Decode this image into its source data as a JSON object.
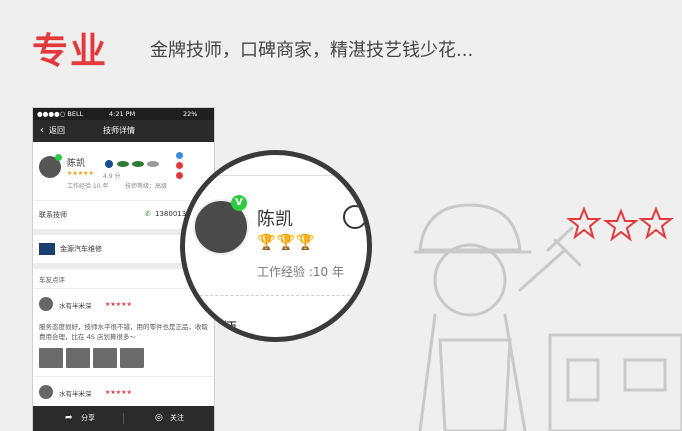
{
  "header": {
    "title": "专业",
    "tagline": "金牌技师，口碑商家，精湛技艺钱少花..."
  },
  "phone": {
    "status": {
      "carrier": "●●●●○ BELL",
      "time": "4:21 PM",
      "battery": "22%"
    },
    "nav": {
      "back": "返回",
      "title": "技师详情"
    },
    "profile": {
      "name": "陈凯",
      "score": "4.9 分",
      "experience": "工作经验:10 年",
      "level": "技师等级：高级"
    },
    "contact": {
      "label": "联系技师",
      "phone": "1380013"
    },
    "shop": {
      "name": "金源汽车维修"
    },
    "reviews": {
      "heading": "车友点评",
      "items": [
        {
          "user": "水有半米深",
          "stars": "★★★★★",
          "text": "服务态度很好，技师水平很不错，用的零件也是正品，收取费用合理，比在 4S 店划算很多～"
        },
        {
          "user": "水有半米深",
          "stars": "★★★★★"
        }
      ]
    },
    "tabbar": {
      "share": "分享",
      "follow": "关注"
    }
  },
  "magnifier": {
    "name": "陈凯",
    "experience": "工作经验 :10 年",
    "partial": "联系技师",
    "badge": "V"
  },
  "colors": {
    "brand_red": "#e4393c",
    "star_orange": "#f39c12",
    "dark": "#2a2a2a"
  }
}
